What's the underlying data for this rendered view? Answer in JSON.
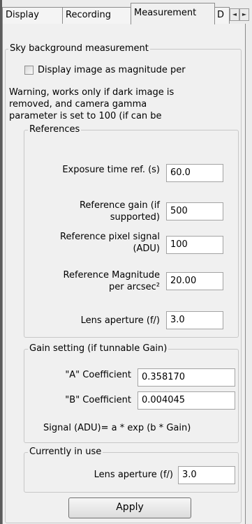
{
  "tabs": [
    {
      "label": "Display"
    },
    {
      "label": "Recording"
    },
    {
      "label": "Measurement"
    },
    {
      "label": "D"
    }
  ],
  "tab_scroll": {
    "left": "◄",
    "right": "►"
  },
  "sky": {
    "title": "Sky background measurement",
    "checkbox_label": "Display image as magnitude per",
    "checkbox_checked": false,
    "warning": [
      "Warning, works only if dark image is",
      "removed, and camera gamma",
      "parameter is set to 100 (if can be"
    ]
  },
  "references": {
    "title": "References",
    "exposure": {
      "label": "Exposure time ref. (s)",
      "value": "60.0"
    },
    "gain": {
      "label1": "Reference gain (if",
      "label2": "supported)",
      "value": "500"
    },
    "pixel": {
      "label1": "Reference pixel signal",
      "label2": "(ADU)",
      "value": "100"
    },
    "magnitude": {
      "label1": "Reference Magnitude",
      "label2": "per arcsec²",
      "value": "20.00"
    },
    "aperture": {
      "label": "Lens aperture (f/)",
      "value": "3.0"
    }
  },
  "gain_setting": {
    "title": "Gain setting (if tunnable Gain)",
    "a": {
      "label": "\"A\" Coefficient",
      "value": "0.358170"
    },
    "b": {
      "label": "\"B\" Coefficient",
      "value": "0.004045"
    },
    "formula": "Signal (ADU)= a * exp (b * Gain)"
  },
  "current": {
    "title": "Currently in use",
    "aperture": {
      "label": "Lens aperture (f/)",
      "value": "3.0"
    }
  },
  "apply_label": "Apply"
}
